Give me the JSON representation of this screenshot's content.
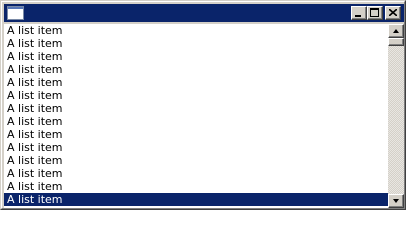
{
  "window": {
    "title": "",
    "colors": {
      "titlebar": "#0a246a",
      "selection": "#0a246a",
      "face": "#d4d0c8"
    }
  },
  "titlebar": {
    "icon": "app-window-icon",
    "buttons": [
      "minimize-icon",
      "maximize-icon",
      "close-icon"
    ]
  },
  "list": {
    "items": [
      {
        "label": "A list item",
        "selected": false
      },
      {
        "label": "A list item",
        "selected": false
      },
      {
        "label": "A list item",
        "selected": false
      },
      {
        "label": "A list item",
        "selected": false
      },
      {
        "label": "A list item",
        "selected": false
      },
      {
        "label": "A list item",
        "selected": false
      },
      {
        "label": "A list item",
        "selected": false
      },
      {
        "label": "A list item",
        "selected": false
      },
      {
        "label": "A list item",
        "selected": false
      },
      {
        "label": "A list item",
        "selected": false
      },
      {
        "label": "A list item",
        "selected": false
      },
      {
        "label": "A list item",
        "selected": false
      },
      {
        "label": "A list item",
        "selected": false
      },
      {
        "label": "A list item",
        "selected": true
      }
    ]
  },
  "scrollbar": {
    "position_fraction": 0.0
  }
}
